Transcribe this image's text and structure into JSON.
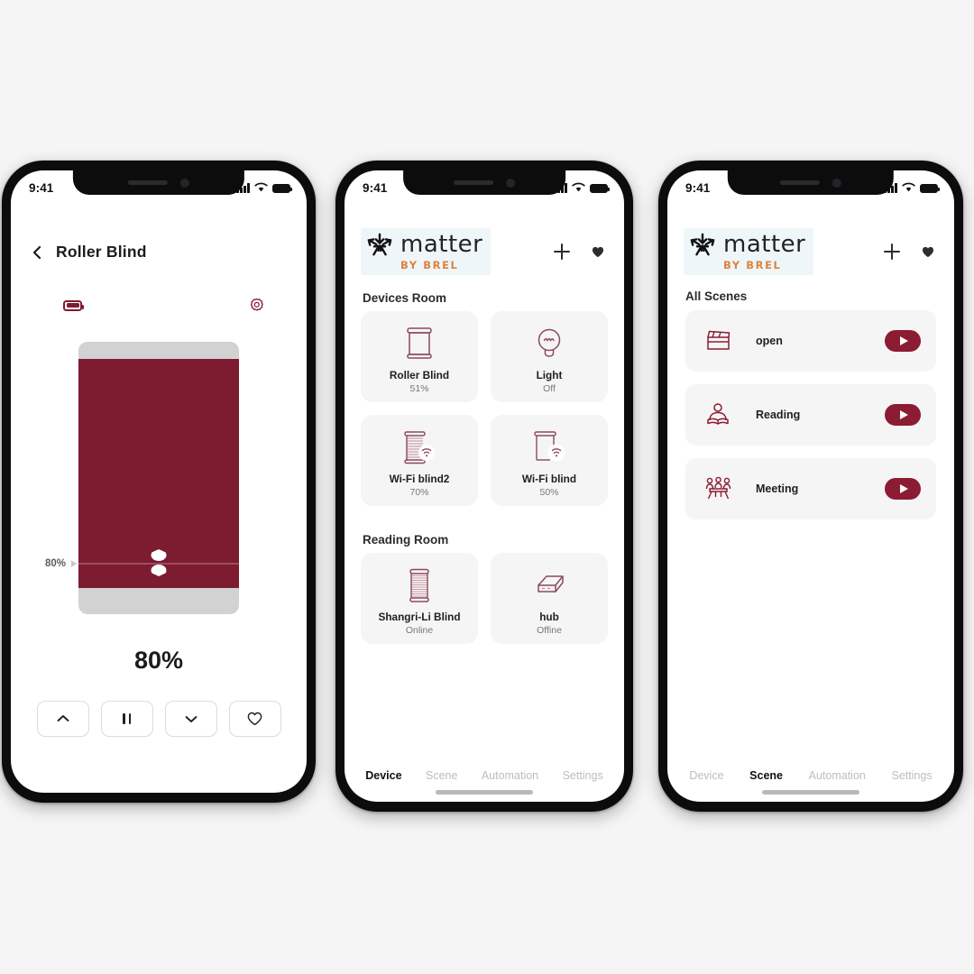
{
  "background_color": "#f5f5f5",
  "accent_color": "#7d1b31",
  "accent_color_dark": "#8b1c33",
  "brand_orange": "#e0823c",
  "status_bar": {
    "time": "9:41",
    "signal_icon": "cellular-signal-icon",
    "wifi_icon": "wifi-icon",
    "battery_icon": "battery-icon"
  },
  "phone1": {
    "name": "roller-blind-detail-screen",
    "back_icon": "back-chevron-icon",
    "title": "Roller Blind",
    "battery_icon": "device-battery-icon",
    "settings_icon": "gear-icon",
    "blind": {
      "position_percent": 80,
      "slider_label": "80%",
      "handle_icon": "slider-handle-icon",
      "shade_color": "#7d1b31",
      "track_color": "#d2d2d2"
    },
    "big_value": "80%",
    "controls": [
      {
        "name": "open-up-button",
        "icon": "chevron-up-icon"
      },
      {
        "name": "pause-button",
        "icon": "pause-icon"
      },
      {
        "name": "close-down-button",
        "icon": "chevron-down-icon"
      },
      {
        "name": "favorite-button",
        "icon": "heart-outline-icon"
      }
    ]
  },
  "phone2": {
    "name": "devices-screen",
    "logo": {
      "word": "matter",
      "sub": "BY BREL",
      "mark_icon": "matter-logo-icon"
    },
    "actions": [
      {
        "name": "add-button",
        "icon": "plus-icon"
      },
      {
        "name": "favorites-button",
        "icon": "heart-filled-icon"
      }
    ],
    "sections": [
      {
        "label": "Devices Room",
        "devices": [
          {
            "name": "Roller Blind",
            "status": "51%",
            "icon": "roller-blind-icon"
          },
          {
            "name": "Light",
            "status": "Off",
            "icon": "light-bulb-icon"
          },
          {
            "name": "Wi-Fi blind2",
            "status": "70%",
            "icon": "wifi-blind-striped-icon"
          },
          {
            "name": "Wi-Fi blind",
            "status": "50%",
            "icon": "wifi-blind-icon"
          }
        ]
      },
      {
        "label": "Reading Room",
        "devices": [
          {
            "name": "Shangri-Li Blind",
            "status": "Online",
            "icon": "shangri-la-blind-icon"
          },
          {
            "name": "hub",
            "status": "Offine",
            "icon": "hub-box-icon"
          }
        ]
      }
    ],
    "tabs": [
      {
        "label": "Device",
        "active": true
      },
      {
        "label": "Scene",
        "active": false
      },
      {
        "label": "Automation",
        "active": false
      },
      {
        "label": "Settings",
        "active": false
      }
    ]
  },
  "phone3": {
    "name": "scenes-screen",
    "logo": {
      "word": "matter",
      "sub": "BY BREL",
      "mark_icon": "matter-logo-icon"
    },
    "actions": [
      {
        "name": "add-button",
        "icon": "plus-icon"
      },
      {
        "name": "favorites-button",
        "icon": "heart-filled-icon"
      }
    ],
    "section_label": "All Scenes",
    "scenes": [
      {
        "name": "open",
        "icon": "clapperboard-icon",
        "play_icon": "play-icon"
      },
      {
        "name": "Reading",
        "icon": "person-reading-icon",
        "play_icon": "play-icon"
      },
      {
        "name": "Meeting",
        "icon": "meeting-people-icon",
        "play_icon": "play-icon"
      }
    ],
    "tabs": [
      {
        "label": "Device",
        "active": false
      },
      {
        "label": "Scene",
        "active": true
      },
      {
        "label": "Automation",
        "active": false
      },
      {
        "label": "Settings",
        "active": false
      }
    ]
  }
}
